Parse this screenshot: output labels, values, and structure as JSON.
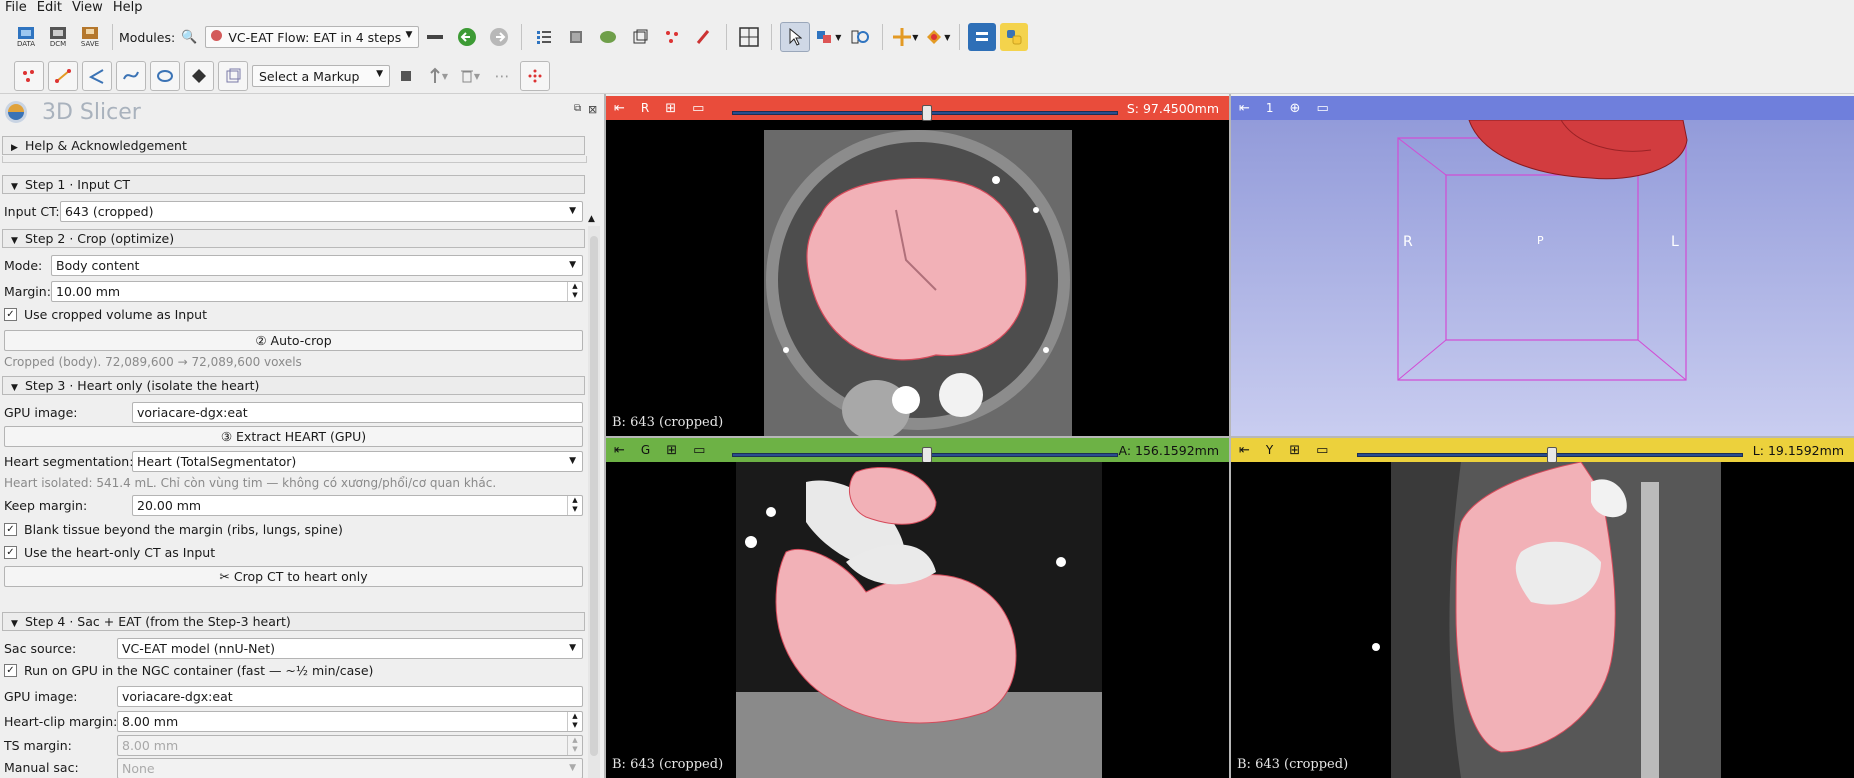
{
  "menu": [
    "File",
    "Edit",
    "View",
    "Help"
  ],
  "toolbar": {
    "modules_label": "Modules:",
    "module_value": "VC-EAT Flow: EAT in 4 steps",
    "data_label": "DATA",
    "dcm_label": "DCM",
    "save_label": "SAVE"
  },
  "markups_toolbar": {
    "select_markup": "Select a Markup"
  },
  "app": {
    "title": "3D Slicer"
  },
  "help_section": "Help & Acknowledgement",
  "step1": {
    "title": "Step 1 · Input CT",
    "input_label": "Input CT:",
    "input_value": "643 (cropped)"
  },
  "step2": {
    "title": "Step 2 · Crop (optimize)",
    "mode_label": "Mode:",
    "mode_value": "Body content",
    "margin_label": "Margin:",
    "margin_value": "10.00 mm",
    "use_cropped": "Use cropped volume as Input",
    "autocrop": "② Auto-crop",
    "status": "Cropped (body). 72,089,600 → 72,089,600 voxels"
  },
  "step3": {
    "title": "Step 3 · Heart only (isolate the heart)",
    "gpu_label": "GPU image:",
    "gpu_value": "voriacare-dgx:eat",
    "extract": "③ Extract HEART (GPU)",
    "seg_label": "Heart segmentation:",
    "seg_value": "Heart (TotalSegmentator)",
    "status": "Heart isolated: 541.4 mL. Chỉ còn vùng tim — không có xương/phổi/cơ quan khác.",
    "keep_label": "Keep margin:",
    "keep_value": "20.00 mm",
    "blank_tissue": "Blank tissue beyond the margin (ribs, lungs, spine)",
    "use_heart_only": "Use the heart-only CT as Input",
    "crop_btn": "✂ Crop CT to heart only"
  },
  "step4": {
    "title": "Step 4 · Sac + EAT (from the Step-3 heart)",
    "sac_label": "Sac source:",
    "sac_value": "VC-EAT model (nnU-Net)",
    "run_gpu": "Run on GPU in the NGC container (fast — ~½ min/case)",
    "gpu_label": "GPU image:",
    "gpu_value": "voriacare-dgx:eat",
    "clip_label": "Heart-clip margin:",
    "clip_value": "8.00 mm",
    "ts_label": "TS margin:",
    "ts_value": "8.00 mm",
    "manual_label": "Manual sac:",
    "manual_value": "None"
  },
  "views": {
    "red": {
      "letter": "R",
      "value": "S: 97.4500mm",
      "bg_label": "B: 643 (cropped)",
      "slider_fraction": 0.5,
      "color": "#e94c3b"
    },
    "threeD": {
      "letter": "1",
      "color": "#6f7fdc",
      "orient_R": "R",
      "orient_L": "L",
      "orient_P": "P"
    },
    "green": {
      "letter": "G",
      "value": "A: 156.1592mm",
      "bg_label": "B: 643 (cropped)",
      "slider_fraction": 0.5,
      "color": "#6db245"
    },
    "yellow": {
      "letter": "Y",
      "value": "L: 19.1592mm",
      "bg_label": "B: 643 (cropped)",
      "slider_fraction": 0.5,
      "color": "#ecd13c"
    }
  }
}
